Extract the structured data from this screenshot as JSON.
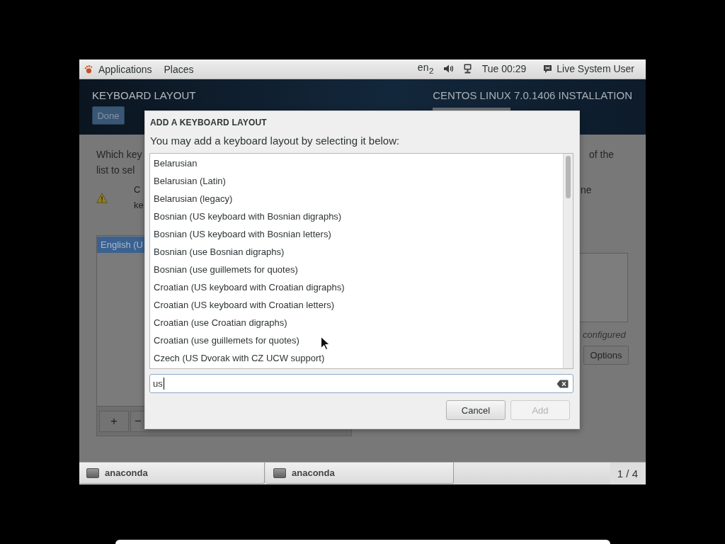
{
  "top_bar": {
    "applications": "Applications",
    "places": "Places",
    "keyboard_layout": "en$_{2}$",
    "clock": "Tue 00:29",
    "user": "Live System User"
  },
  "header": {
    "title": "KEYBOARD LAYOUT",
    "done_button": "Done",
    "product": "CENTOS LINUX 7.0.1406 INSTALLATION"
  },
  "background": {
    "intro_left": [
      "Which key",
      "list to sel"
    ],
    "warning_left": [
      "C",
      "ke"
    ],
    "layouts": [
      {
        "label": "English (U",
        "selected": true
      }
    ],
    "list_buttons": [
      "+",
      "−"
    ],
    "intro_right": "of the",
    "warning_right": "ne",
    "status": "configured",
    "options_button": "Options"
  },
  "dialog": {
    "title": "ADD A KEYBOARD LAYOUT",
    "prompt": "You may add a keyboard layout by selecting it below:",
    "layouts": [
      {
        "label": "Belarusian",
        "selected": false
      },
      {
        "label": "Belarusian (Latin)",
        "selected": false
      },
      {
        "label": "Belarusian (legacy)",
        "selected": false
      },
      {
        "label": "Bosnian (US keyboard with Bosnian digraphs)",
        "selected": false
      },
      {
        "label": "Bosnian (US keyboard with Bosnian letters)",
        "selected": false
      },
      {
        "label": "Bosnian (use Bosnian digraphs)",
        "selected": false
      },
      {
        "label": "Bosnian (use guillemets for quotes)",
        "selected": false
      },
      {
        "label": "Croatian (US keyboard with Croatian digraphs)",
        "selected": false
      },
      {
        "label": "Croatian (US keyboard with Croatian letters)",
        "selected": false
      },
      {
        "label": "Croatian (use Croatian digraphs)",
        "selected": false
      },
      {
        "label": "Croatian (use guillemets for quotes)",
        "selected": false
      },
      {
        "label": "Czech (US Dvorak with CZ UCW support)",
        "selected": false
      }
    ],
    "search": {
      "value": "us"
    },
    "buttons": [
      {
        "label": "Cancel",
        "disabled": false
      },
      {
        "label": "Add",
        "disabled": true
      }
    ]
  },
  "taskbar": {
    "windows": [
      {
        "label": "anaconda"
      },
      {
        "label": "anaconda"
      }
    ],
    "workspace": "1 / 4"
  }
}
